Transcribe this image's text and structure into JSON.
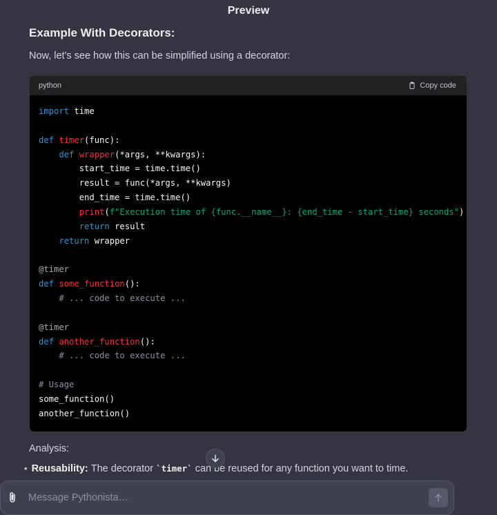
{
  "header": {
    "title": "Preview"
  },
  "content": {
    "heading": "Example With Decorators:",
    "intro": "Now, let's see how this can be simplified using a decorator:",
    "analysis": "Analysis:",
    "bullet": {
      "label": "Reusability:",
      "text_before": "The decorator",
      "code": "`timer`",
      "text_after": "can be reused for any function you want to time."
    }
  },
  "code_block": {
    "language": "python",
    "copy_label": "Copy code",
    "lines": [
      [
        [
          "kw",
          "import"
        ],
        [
          "",
          " time"
        ]
      ],
      [],
      [
        [
          "kw",
          "def"
        ],
        [
          "",
          " "
        ],
        [
          "fn",
          "timer"
        ],
        [
          "",
          "(func):"
        ]
      ],
      [
        [
          "",
          "    "
        ],
        [
          "kw",
          "def"
        ],
        [
          "",
          " "
        ],
        [
          "fn",
          "wrapper"
        ],
        [
          "",
          "(*args, **kwargs):"
        ]
      ],
      [
        [
          "",
          "        start_time = time.time()"
        ]
      ],
      [
        [
          "",
          "        result = func(*args, **kwargs)"
        ]
      ],
      [
        [
          "",
          "        end_time = time.time()"
        ]
      ],
      [
        [
          "",
          "        "
        ],
        [
          "fn",
          "print"
        ],
        [
          "",
          "("
        ],
        [
          "str",
          "f\"Execution time of {func.__name__}: {end_time - start_time} seconds\""
        ],
        [
          "",
          ")"
        ]
      ],
      [
        [
          "",
          "        "
        ],
        [
          "kw",
          "return"
        ],
        [
          "",
          " result"
        ]
      ],
      [
        [
          "",
          "    "
        ],
        [
          "kw",
          "return"
        ],
        [
          "",
          " wrapper"
        ]
      ],
      [],
      [
        [
          "dec",
          "@timer"
        ]
      ],
      [
        [
          "kw",
          "def"
        ],
        [
          "",
          " "
        ],
        [
          "fn",
          "some_function"
        ],
        [
          "",
          "():"
        ]
      ],
      [
        [
          "",
          "    "
        ],
        [
          "cm",
          "# ... code to execute ..."
        ]
      ],
      [],
      [
        [
          "dec",
          "@timer"
        ]
      ],
      [
        [
          "kw",
          "def"
        ],
        [
          "",
          " "
        ],
        [
          "fn",
          "another_function"
        ],
        [
          "",
          "():"
        ]
      ],
      [
        [
          "",
          "    "
        ],
        [
          "cm",
          "# ... code to execute ..."
        ]
      ],
      [],
      [
        [
          "cm",
          "# Usage"
        ]
      ],
      [
        [
          "",
          "some_function()"
        ]
      ],
      [
        [
          "",
          "another_function()"
        ]
      ]
    ]
  },
  "composer": {
    "placeholder": "Message Pythonista…"
  },
  "icons": {
    "copy": "clipboard-icon",
    "scroll": "arrow-down-icon",
    "attach": "paperclip-icon",
    "send": "arrow-up-icon"
  },
  "colors": {
    "background": "#343541",
    "code_bg": "#000000",
    "keyword": "#2e95d3",
    "function": "#f22c3d",
    "string": "#00a67d",
    "comment": "#8e8ea0"
  }
}
